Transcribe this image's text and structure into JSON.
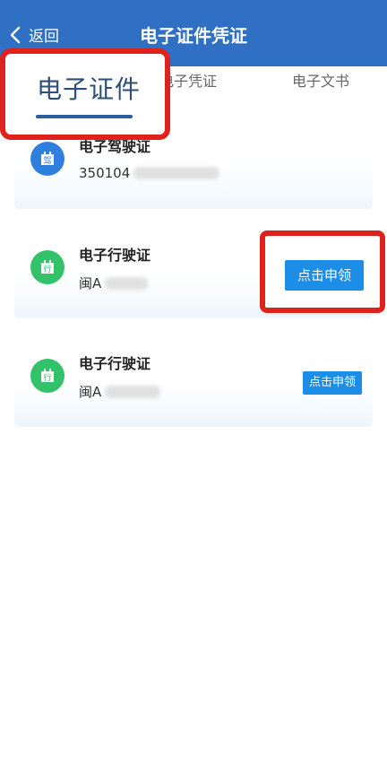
{
  "header": {
    "back_label": "返回",
    "title": "电子证件凭证"
  },
  "tabs": [
    {
      "label": "电子证件",
      "selected": true
    },
    {
      "label": "电子凭证",
      "visible_fragment": "电子凭证"
    },
    {
      "label": "电子文书"
    }
  ],
  "cards": [
    {
      "title": "电子驾驶证",
      "subtitle_prefix": "350104",
      "icon_glyph": "驾",
      "icon_name": "drivers-license-icon",
      "has_claim_button": false
    },
    {
      "title": "电子行驶证",
      "subtitle_prefix": "闽A",
      "icon_glyph": "行",
      "icon_name": "vehicle-license-icon",
      "has_claim_button": true,
      "claim_label": "点击申领"
    },
    {
      "title": "电子行驶证",
      "subtitle_prefix": "闽A",
      "icon_glyph": "行",
      "icon_name": "vehicle-license-icon",
      "has_claim_button": true,
      "claim_label": "点击申领"
    }
  ],
  "colors": {
    "header_bg": "#2f6fc4",
    "highlight": "#e0221c",
    "button_bg": "#1d8ee8",
    "icon_blue": "#2e7fde",
    "icon_green": "#33c16a"
  }
}
